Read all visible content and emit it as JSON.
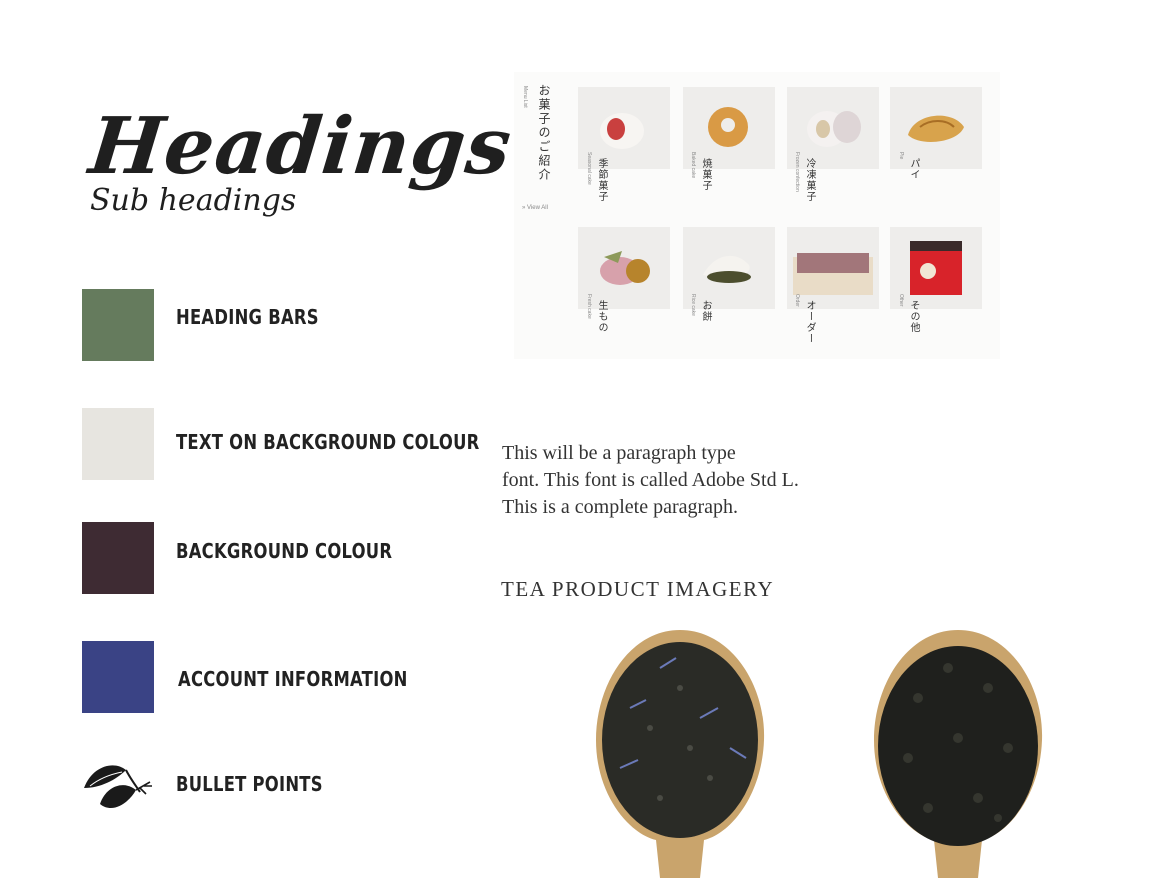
{
  "headings": {
    "title": "Headings",
    "subtitle": "Sub headings"
  },
  "swatches": [
    {
      "label": "HEADING BARS",
      "color": "#657b5d"
    },
    {
      "label": "TEXT ON BACKGROUND COLOUR",
      "color": "#e7e5e0"
    },
    {
      "label": "BACKGROUND COLOUR",
      "color": "#3e2b33"
    },
    {
      "label": "ACCOUNT INFORMATION",
      "color": "#3a4385"
    }
  ],
  "bullet": {
    "label": "BULLET POINTS",
    "icon": "leaf-icon"
  },
  "menu": {
    "title": "お菓子のご紹介",
    "subtitle": "Menu List",
    "view_all": "» View All",
    "items": [
      {
        "jp": "季節菓子",
        "en": "Seasonal cake"
      },
      {
        "jp": "焼菓子",
        "en": "Baked cake"
      },
      {
        "jp": "冷凍菓子",
        "en": "Frozen confection"
      },
      {
        "jp": "パイ",
        "en": "Pie"
      },
      {
        "jp": "生もの",
        "en": "Fresh cake"
      },
      {
        "jp": "お餅",
        "en": "Rice cake"
      },
      {
        "jp": "オーダー",
        "en": "Order"
      },
      {
        "jp": "その他",
        "en": "Other"
      }
    ]
  },
  "paragraph": {
    "line1": "This will be a paragraph type",
    "line2": "font. This font is called Adobe Std L.",
    "line3": "This is a complete paragraph."
  },
  "tea": {
    "title": "TEA PRODUCT IMAGERY"
  }
}
